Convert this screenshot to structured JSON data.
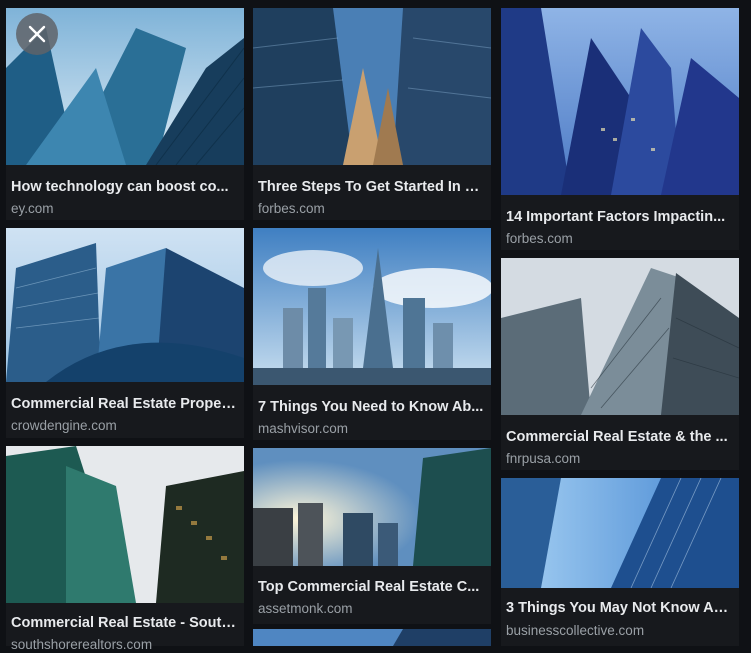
{
  "close_label": "Close",
  "results": [
    {
      "title": "How technology can boost co...",
      "source": "ey.com",
      "icon": "skyscraper-image"
    },
    {
      "title": "Commercial Real Estate Proper...",
      "source": "crowdengine.com",
      "icon": "skyscraper-image"
    },
    {
      "title": "Commercial Real Estate - South...",
      "source": "southshorerealtors.com",
      "icon": "skyscraper-image"
    },
    {
      "title": "Three Steps To Get Started In C...",
      "source": "forbes.com",
      "icon": "skyscraper-image"
    },
    {
      "title": "7 Things You Need to Know Ab...",
      "source": "mashvisor.com",
      "icon": "city-skyline-image"
    },
    {
      "title": "Top Commercial Real Estate C...",
      "source": "assetmonk.com",
      "icon": "city-sunset-image"
    },
    {
      "title": "14 Important Factors Impactin...",
      "source": "forbes.com",
      "icon": "skyscraper-image"
    },
    {
      "title": "Commercial Real Estate & the ...",
      "source": "fnrpusa.com",
      "icon": "skyscraper-image"
    },
    {
      "title": "3 Things You May Not Know Ab...",
      "source": "businesscollective.com",
      "icon": "skyscraper-image"
    }
  ]
}
